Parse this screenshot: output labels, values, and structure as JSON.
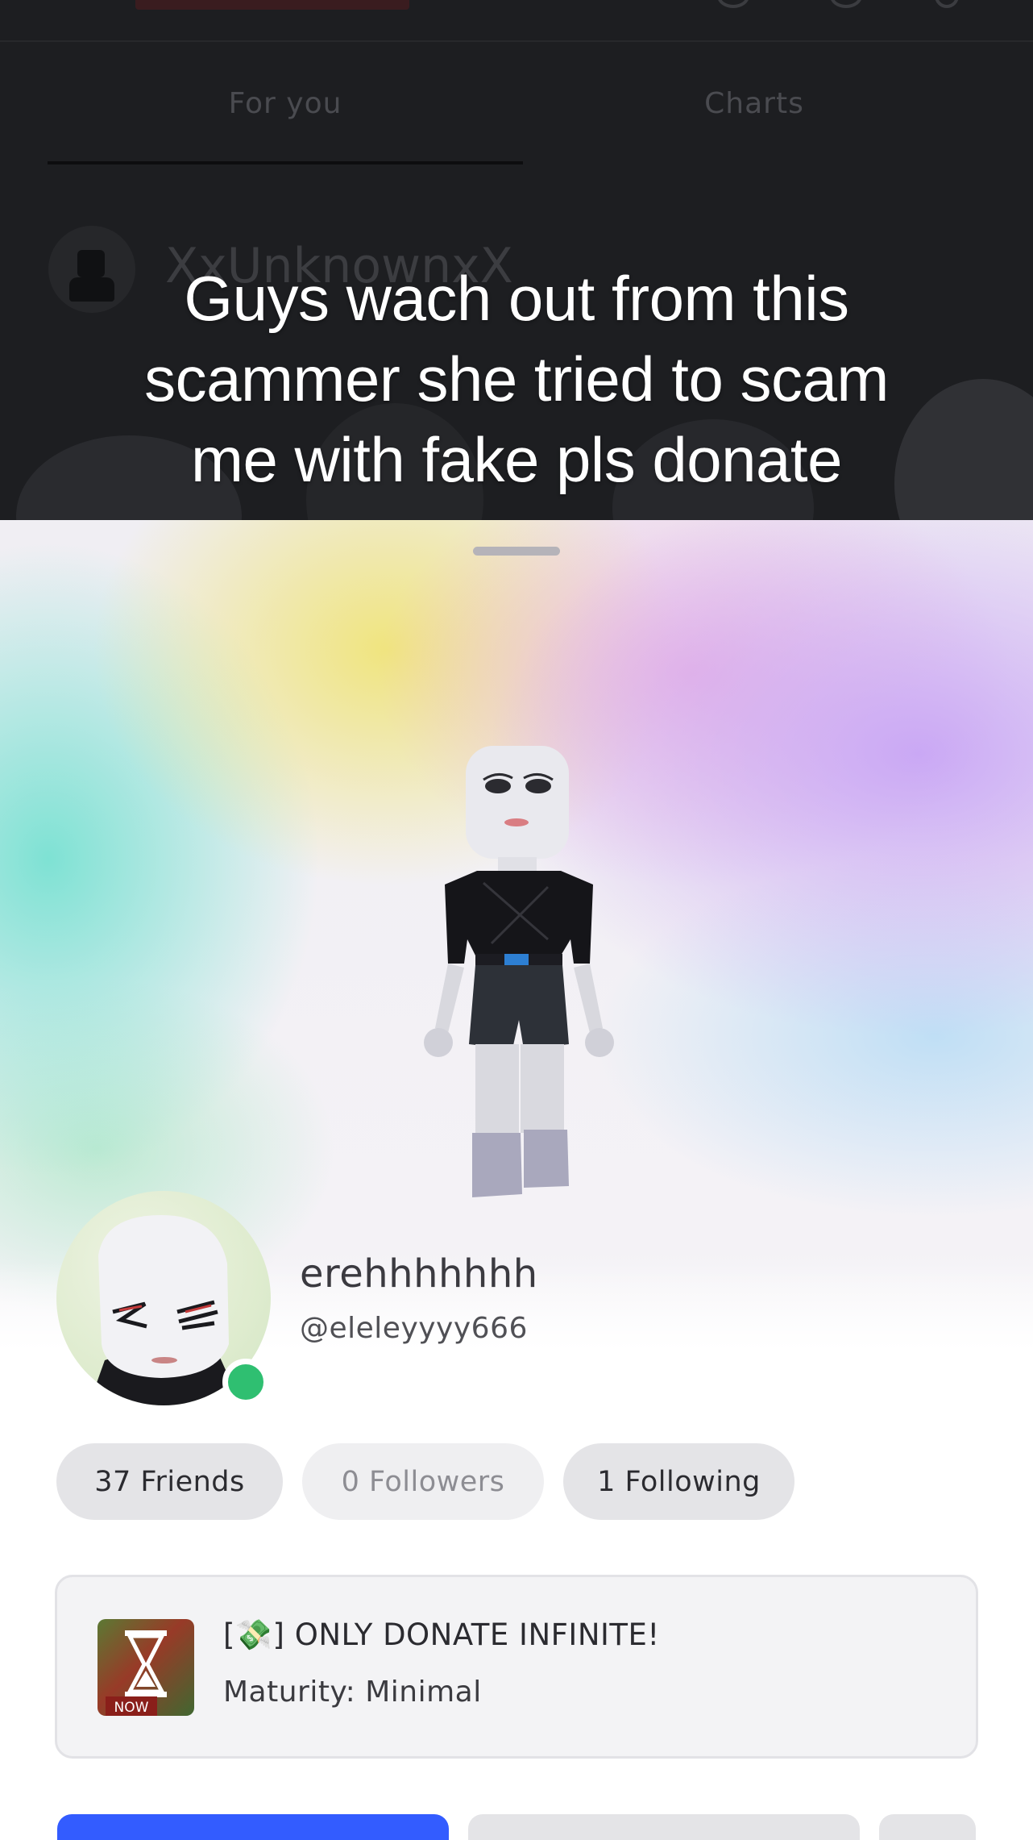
{
  "background_app": {
    "tabs": [
      {
        "label": "For you",
        "selected": true
      },
      {
        "label": "Charts",
        "selected": false
      }
    ],
    "username_partial": "XxUnknownxX"
  },
  "caption": {
    "lines": [
      "Guys wach out from this",
      "scammer she tried to scam",
      "me with fake pls donate"
    ]
  },
  "profile": {
    "display_name": "erehhhhhhh",
    "handle": "@eleleyyyy666",
    "online": true,
    "status_color": "#2fbf71"
  },
  "stats": {
    "friends_label": "37 Friends",
    "followers_label": "0 Followers",
    "following_label": "1 Following"
  },
  "experience": {
    "title": "[💸] ONLY DONATE INFINITE!",
    "maturity": "Maturity: Minimal",
    "thumbnail_badge": "NOW"
  },
  "colors": {
    "primary_button": "#335cff",
    "secondary_button": "#e4e4e7"
  }
}
